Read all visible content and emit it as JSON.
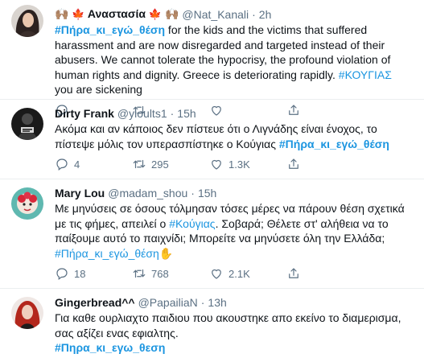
{
  "tweets": [
    {
      "name": "Αναστασία",
      "name_prefix_emoji": "🙌🏽",
      "name_flag": "🍁",
      "name_suffix_emoji": "🙌🏽",
      "handle": "@Nat_Kanali",
      "time": "2h",
      "text_hashtag": "#Πήρα_κι_εγώ_θέση",
      "text_1": " for the kids and the victims that suffered harassment and are now disregarded and targeted instead of their abusers. We cannot tolerate the hypocrisy, the profound violation of human rights and dignity. Greece is deteriorating rapidly. ",
      "text_hashtag2": "#ΚΟΥΓΙΑΣ",
      "text_2": " you are sickening",
      "replies": "",
      "retweets": "",
      "likes": ""
    },
    {
      "name": "Dirty Frank",
      "handle": "@yioults1",
      "time": "15h",
      "text_1": "Ακόμα και αν κάποιος δεν πίστευε ότι ο Λιγνάδης είναι ένοχος, το πίστεψε μόλις τον υπερασπίστηκε ο Κούγιας ",
      "text_hashtag": "#Πήρα_κι_εγώ_θέση",
      "replies": "4",
      "retweets": "295",
      "likes": "1.3K"
    },
    {
      "name": "Mary Lou",
      "handle": "@madam_shou",
      "time": "15h",
      "text_1": "Με μηνύσεις σε όσους τόλμησαν τόσες μέρες να πάρουν θέση σχετικά με τις φήμες, απειλεί ο ",
      "text_hashtag": "#Κούγιας",
      "text_2": ". Σοβαρά; Θέλετε στ' αλήθεια να το παίξουμε αυτό το παιχνίδι; Μπορείτε να μηνύσετε όλη την Ελλάδα; ",
      "text_hashtag2": "#Πήρα_κι_εγώ_θέση",
      "text_emoji": "✋",
      "replies": "18",
      "retweets": "768",
      "likes": "2.1K"
    },
    {
      "name": "Gingerbread^^",
      "handle": "@PapailiaN",
      "time": "13h",
      "text_1": "Για καθε ουρλιαχτο παιδιου που ακουστηκε απο εκείνο το διαμερισμα, σας αξίζει ενας εφιαλτης.",
      "text_hashtag": "#Πηρα_κι_εγω_θεση"
    }
  ],
  "separator": "·",
  "icons": [
    "reply-icon",
    "retweet-icon",
    "like-icon",
    "share-icon"
  ],
  "colors": {
    "link": "#1b95e0",
    "secondary": "#5b7083",
    "border": "#ebeef0"
  }
}
